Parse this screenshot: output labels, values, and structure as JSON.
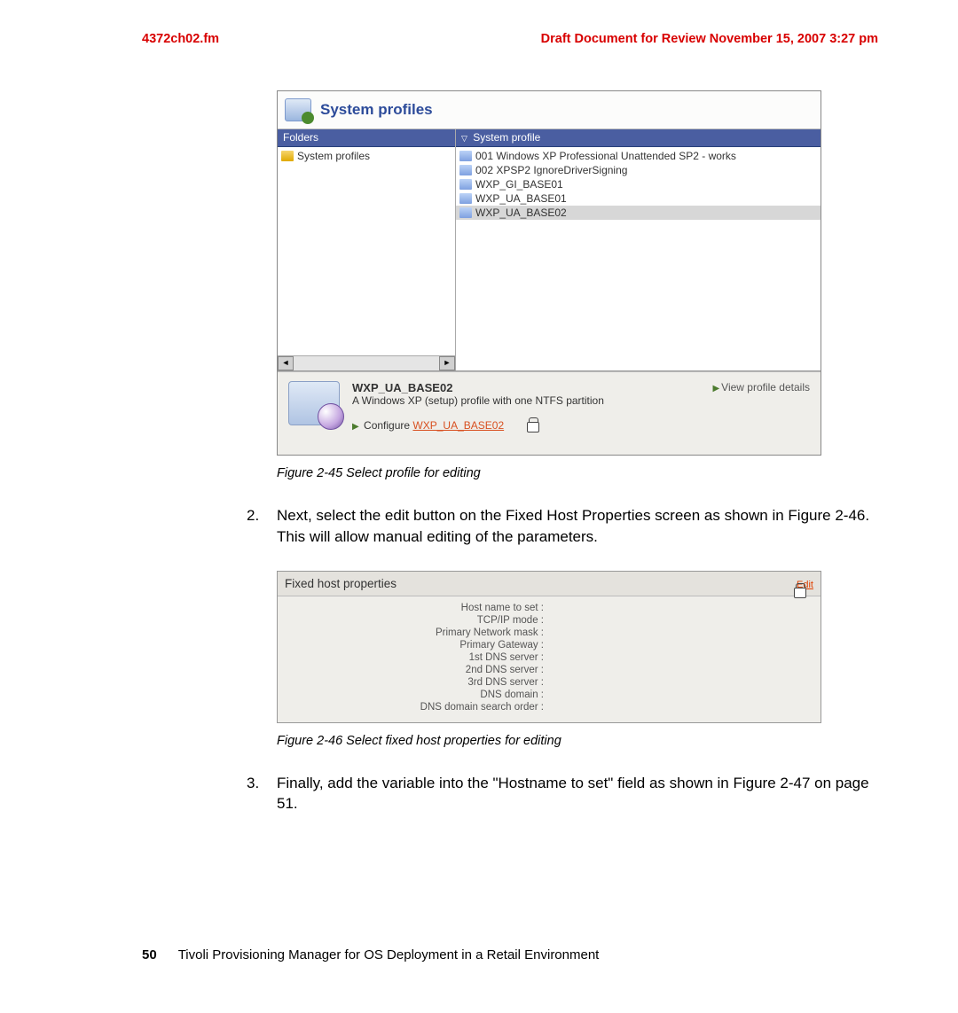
{
  "header": {
    "file": "4372ch02.fm",
    "draft": "Draft Document for Review November 15, 2007 3:27 pm"
  },
  "fig45": {
    "title": "System profiles",
    "leftHeader": "Folders",
    "rightHeader": "System profile",
    "folders": [
      "System profiles"
    ],
    "profiles": [
      "001 Windows XP Professional Unattended SP2 - works",
      "002 XPSP2 IgnoreDriverSigning",
      "WXP_GI_BASE01",
      "WXP_UA_BASE01",
      "WXP_UA_BASE02"
    ],
    "selectedIndex": 4,
    "detail": {
      "name": "WXP_UA_BASE02",
      "desc": "A Windows XP (setup) profile with one NTFS partition",
      "configurePrefix": "Configure ",
      "configureLink": "WXP_UA_BASE02",
      "viewDetails": "View profile details"
    },
    "caption": "Figure 2-45   Select profile for editing"
  },
  "step2": {
    "num": "2.",
    "text": "Next, select the edit button on the Fixed Host Properties screen as shown in Figure 2-46. This will allow manual editing of the parameters."
  },
  "fig46": {
    "title": "Fixed host properties",
    "edit": "Edit",
    "props": [
      "Host name to set :",
      "TCP/IP mode :",
      "Primary Network mask :",
      "Primary Gateway :",
      "1st DNS server :",
      "2nd DNS server :",
      "3rd DNS server :",
      "DNS domain :",
      "DNS domain search order :"
    ],
    "caption": "Figure 2-46   Select fixed host properties for editing"
  },
  "step3": {
    "num": "3.",
    "text": "Finally, add the variable into the \"Hostname to set\" field as shown in Figure 2-47 on page 51."
  },
  "footer": {
    "page": "50",
    "title": "Tivoli Provisioning Manager for OS Deployment in a Retail Environment"
  }
}
